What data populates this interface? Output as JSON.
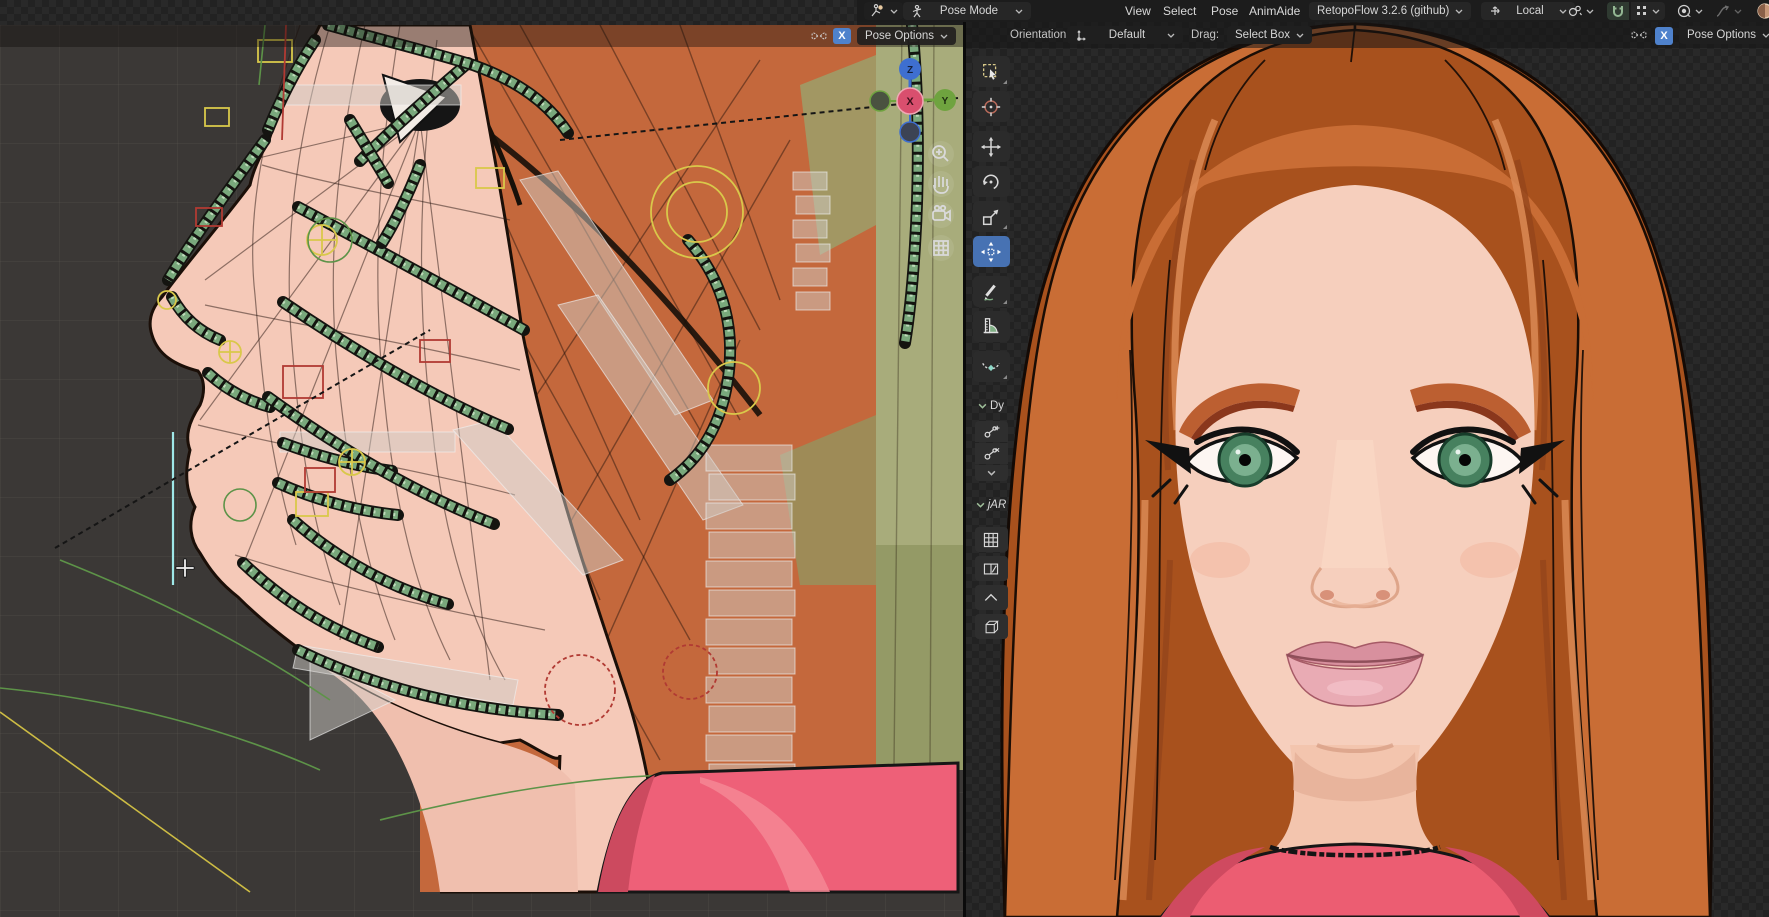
{
  "app": "Blender 3D - dual viewport pose mode",
  "colors": {
    "accent_blue": "#4f82cc",
    "tool_active_blue": "#4772b3",
    "snap_active_green": "#93b793",
    "bone_green": "#7fb287",
    "skin": "#f5cbb9",
    "hair_orange": "#c4683c",
    "shirt_pink": "#ee5f74",
    "eye_green": "#47815f"
  },
  "left_viewport": {
    "header": {
      "symmetry_icon": "butterfly-mirror-icon",
      "x_axis_toggle": "X",
      "pose_options_label": "Pose Options",
      "dropdown_icon": "chevron-down-icon"
    },
    "gizmo": {
      "x": "X",
      "y": "Y",
      "z": "Z"
    },
    "corner_icons": [
      "zoom-icon",
      "pan-hand-icon",
      "camera-view-icon",
      "grid-ortho-icon"
    ],
    "cursor": "crosshair-move-cursor"
  },
  "right_viewport": {
    "menubar": {
      "editor_mode_icon": "armature-icon",
      "mode_selector": "Pose Mode",
      "mode_selector_icon": "pose-figure-icon",
      "menus": [
        "View",
        "Select",
        "Pose",
        "AnimAide"
      ],
      "addon_button": "RetopoFlow 3.2.6 (github)",
      "transform_orientation": "Local",
      "transform_orientation_icon": "orientation-arrows-icon",
      "pivot_icon": "pivot-point-icon",
      "snap_icon": "magnet-icon",
      "snap_target_icon": "snap-increment-dots-icon",
      "proportional_icon": "proportional-editing-icon",
      "falloff_icon": "falloff-curve-icon",
      "edge_icon": "viewport-shading-sphere-icon"
    },
    "tool_settings": {
      "orientation_label": "Orientation:",
      "orientation_value": "Default",
      "orientation_icon": "axis-gizmo-icon",
      "drag_label": "Drag:",
      "drag_value": "Select Box",
      "symmetry_icon": "butterfly-mirror-icon",
      "x_axis_toggle": "X",
      "pose_options_label": "Pose Options"
    },
    "toolbar": {
      "tools": [
        {
          "name": "select-box",
          "icon": "box-select-icon"
        },
        {
          "name": "cursor",
          "icon": "cursor-tool-icon"
        },
        {
          "name": "move",
          "icon": "move-arrows-icon"
        },
        {
          "name": "rotate",
          "icon": "rotate-arc-icon"
        },
        {
          "name": "scale",
          "icon": "scale-arrow-icon"
        },
        {
          "name": "transform",
          "icon": "transform-gizmo-icon",
          "active": true
        },
        {
          "name": "annotate",
          "icon": "pencil-icon"
        },
        {
          "name": "measure",
          "icon": "ruler-protractor-icon"
        },
        {
          "name": "pose-breakdowner",
          "icon": "dashed-curve-diamond-icon"
        }
      ],
      "panels": [
        {
          "label": "Dy",
          "chevron": "chevron-down-icon",
          "buttons": [
            "bone-add-icon",
            "bone-remove-icon",
            "chevron-down-icon"
          ]
        },
        {
          "label": "jAR",
          "chevron": "chevron-down-icon",
          "buttons": [
            "grid-snap-icon",
            "split-rect-icon",
            "caret-up-icon",
            "cube-icon"
          ]
        }
      ]
    }
  }
}
